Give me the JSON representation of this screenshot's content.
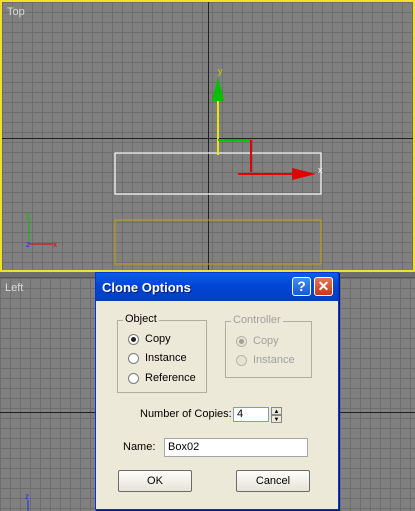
{
  "viewports": {
    "top_label": "Top",
    "left_label": "Left",
    "axis_y": "y",
    "axis_x": "x",
    "axis_z": "z"
  },
  "dialog": {
    "title": "Clone Options",
    "help_glyph": "?",
    "close_glyph": "✕",
    "object_group": {
      "title": "Object",
      "options": [
        "Copy",
        "Instance",
        "Reference"
      ],
      "selected": "Copy"
    },
    "controller_group": {
      "title": "Controller",
      "options": [
        "Copy",
        "Instance"
      ],
      "selected": "Copy",
      "disabled": true
    },
    "copies_label": "Number of Copies:",
    "copies_value": "4",
    "name_label": "Name:",
    "name_value": "Box02",
    "ok_label": "OK",
    "cancel_label": "Cancel"
  },
  "colors": {
    "active_viewport_border": "#f2e227",
    "selection_box": "#ffffff",
    "clone_preview": "#c8a000",
    "gizmo_x": "#e00000",
    "gizmo_y": "#00c000",
    "titlebar": "#0045d5"
  }
}
